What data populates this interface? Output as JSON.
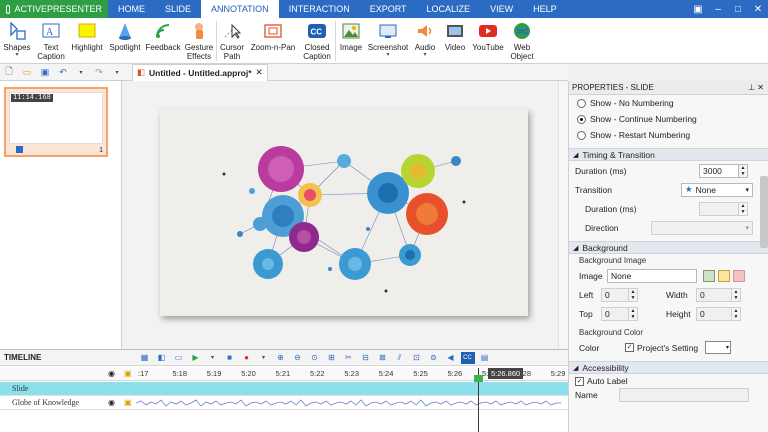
{
  "app": {
    "name": "ACTIVEPRESENTER"
  },
  "menu": {
    "tabs": [
      "HOME",
      "SLIDE",
      "ANNOTATION",
      "INTERACTION",
      "EXPORT",
      "LOCALIZE",
      "VIEW",
      "HELP"
    ],
    "active": "ANNOTATION"
  },
  "ribbon": {
    "shapes": "Shapes",
    "text_caption": [
      "Text",
      "Caption"
    ],
    "highlight": "Highlight",
    "spotlight": "Spotlight",
    "feedback": "Feedback",
    "gesture_effects": [
      "Gesture",
      "Effects"
    ],
    "cursor_path": [
      "Cursor",
      "Path"
    ],
    "zoom_n_pan": "Zoom-n-Pan",
    "closed_caption": [
      "Closed",
      "Caption"
    ],
    "image": "Image",
    "screenshot": "Screenshot",
    "audio": "Audio",
    "video": "Video",
    "youtube": "YouTube",
    "web_object": [
      "Web",
      "Object"
    ]
  },
  "document": {
    "tab_title": "Untitled - Untitled.approj*"
  },
  "slides": {
    "thumbnail_time": "11:14.168",
    "thumbnail_number": "1"
  },
  "timeline": {
    "title": "TIMELINE",
    "ticks": [
      ":17",
      "5:18",
      "5:19",
      "5:20",
      "5:21",
      "5:22",
      "5:23",
      "5:24",
      "5:25",
      "5:26",
      "5:27",
      "5:28",
      "5:29"
    ],
    "current_time": "5:26.860",
    "rows": [
      "Slide",
      "Globe of Knowledge"
    ]
  },
  "properties": {
    "title": "PROPERTIES - SLIDE",
    "numbering": [
      "Show - No Numbering",
      "Show - Continue Numbering",
      "Show - Restart Numbering"
    ],
    "numbering_selected": 1,
    "timing": {
      "header": "Timing & Transition",
      "duration_label": "Duration (ms)",
      "duration_value": "3000",
      "transition_label": "Transition",
      "transition_value": "None",
      "sub_duration_label": "Duration (ms)",
      "direction_label": "Direction"
    },
    "background": {
      "header": "Background",
      "image_group": "Background Image",
      "image_label": "Image",
      "image_value": "None",
      "left_label": "Left",
      "left_value": "0",
      "width_label": "Width",
      "width_value": "0",
      "top_label": "Top",
      "top_value": "0",
      "height_label": "Height",
      "height_value": "0",
      "color_group": "Background Color",
      "color_label": "Color",
      "project_setting": "Project's Setting"
    },
    "accessibility": {
      "header": "Accessibility",
      "auto_label": "Auto Label",
      "name_label": "Name"
    }
  },
  "colors": {
    "accent": "#2b6bc4",
    "app_green": "#2e9e45"
  }
}
